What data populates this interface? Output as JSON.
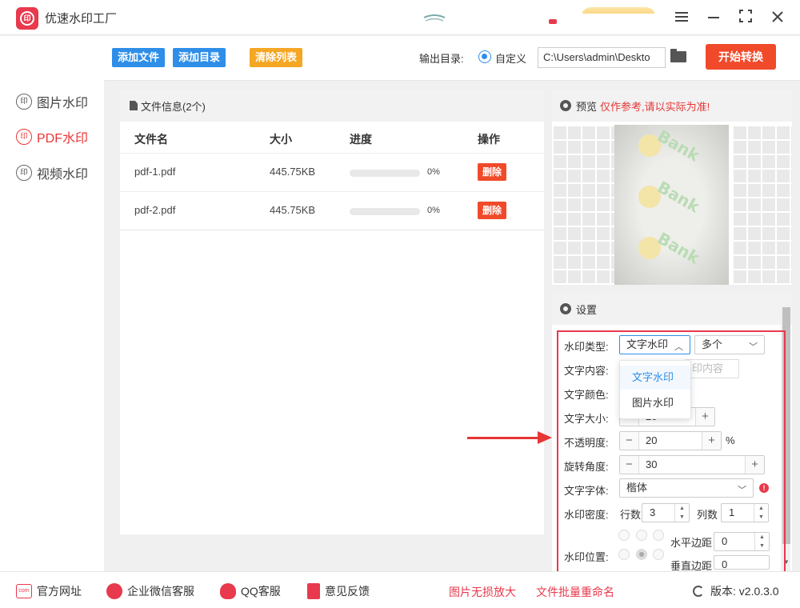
{
  "app": {
    "title": "优速水印工厂"
  },
  "window": {
    "menu_icon": "menu-icon",
    "minimize_icon": "minimize-icon",
    "maximize_icon": "maximize-icon",
    "close_icon": "close-icon"
  },
  "sidebar": {
    "items": [
      {
        "label": "图片水印",
        "icon": "watermark-icon",
        "active": false
      },
      {
        "label": "PDF水印",
        "icon": "watermark-icon",
        "active": true
      },
      {
        "label": "视频水印",
        "icon": "watermark-icon",
        "active": false
      }
    ],
    "icon_glyph": "印"
  },
  "toolbar": {
    "add_file": "添加文件",
    "add_dir": "添加目录",
    "clear_list": "清除列表",
    "output_label": "输出目录:",
    "custom_label": "自定义",
    "output_path": "C:\\Users\\admin\\Deskto",
    "start": "开始转换"
  },
  "files": {
    "header": "文件信息(2个)",
    "columns": {
      "name": "文件名",
      "size": "大小",
      "progress": "进度",
      "action": "操作"
    },
    "rows": [
      {
        "name": "pdf-1.pdf",
        "size": "445.75KB",
        "progress": 0,
        "pct": "0%",
        "delete": "删除"
      },
      {
        "name": "pdf-2.pdf",
        "size": "445.75KB",
        "progress": 0,
        "pct": "0%",
        "delete": "删除"
      }
    ]
  },
  "preview": {
    "title": "预览",
    "warning": "仅作参考,请以实际为准!",
    "watermark_text": "Bank"
  },
  "settings": {
    "title": "设置",
    "labels": {
      "type": "水印类型:",
      "content": "文字内容:",
      "color": "文字颜色:",
      "size": "文字大小:",
      "opacity": "不透明度:",
      "rotation": "旋转角度:",
      "font": "文字字体:",
      "density": "水印密度:",
      "position": "水印位置:"
    },
    "type_value": "文字水印",
    "multi_value": "多个",
    "content_placeholder_fragment": "印内容",
    "size_fragment": "20",
    "opacity_value": "20",
    "opacity_unit": "%",
    "rotation_value": "30",
    "font_value": "楷体",
    "rows_label": "行数",
    "rows_value": "3",
    "cols_label": "列数",
    "cols_value": "1",
    "h_margin_label": "水平边距",
    "h_margin_value": "0",
    "v_margin_label": "垂直边距",
    "v_margin_value": "0",
    "dropdown_options": [
      "文字水印",
      "图片水印"
    ],
    "error_glyph": "!"
  },
  "footer": {
    "website": "官方网址",
    "wechat": "企业微信客服",
    "qq": "QQ客服",
    "feedback": "意见反馈",
    "link1": "图片无损放大",
    "link2": "文件批量重命名",
    "version": "版本: v2.0.3.0",
    "website_icon_text": "com"
  },
  "colors": {
    "accent_blue": "#2e8ee8",
    "accent_red": "#e8394d",
    "start_orange": "#f04a2a",
    "clear_orange": "#f5a623"
  }
}
